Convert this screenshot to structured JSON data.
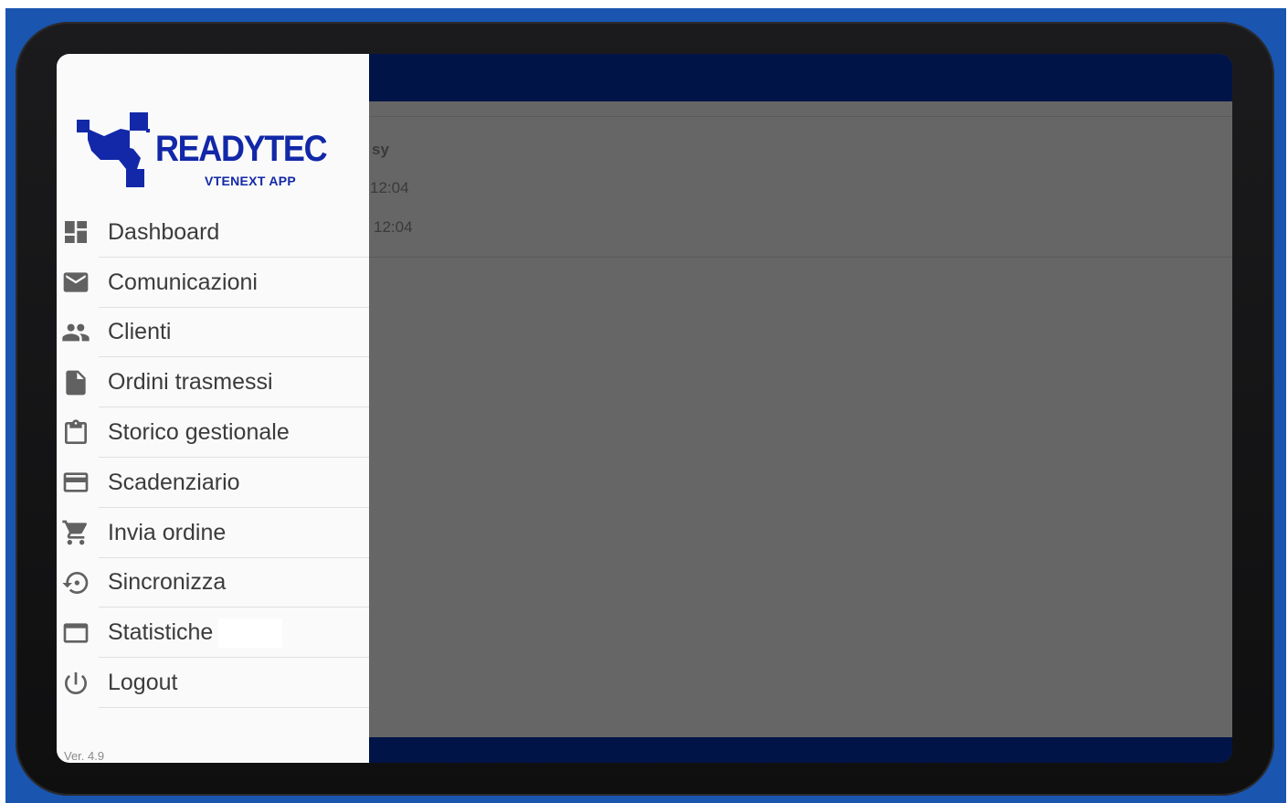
{
  "app": {
    "logo_title": "READYTEC",
    "logo_subtitle": "VTENEXT APP",
    "version": "Ver. 4.9"
  },
  "background_content": {
    "line1": "sy",
    "line2": "12:04",
    "line3": "12:04"
  },
  "menu": [
    {
      "label": "Dashboard",
      "icon": "dashboard-icon"
    },
    {
      "label": "Comunicazioni",
      "icon": "mail-icon"
    },
    {
      "label": "Clienti",
      "icon": "people-icon"
    },
    {
      "label": "Ordini trasmessi",
      "icon": "document-icon"
    },
    {
      "label": "Storico gestionale",
      "icon": "clipboard-icon"
    },
    {
      "label": "Scadenziario",
      "icon": "credit-card-icon"
    },
    {
      "label": "Invia ordine",
      "icon": "cart-icon"
    },
    {
      "label": "Sincronizza",
      "icon": "sync-icon"
    },
    {
      "label": "Statistiche",
      "icon": "window-icon"
    },
    {
      "label": "Logout",
      "icon": "power-icon"
    }
  ],
  "colors": {
    "brand": "#1228a8",
    "app_bar": "#001447",
    "scrim": "#666666",
    "frame": "#1a55b0"
  }
}
